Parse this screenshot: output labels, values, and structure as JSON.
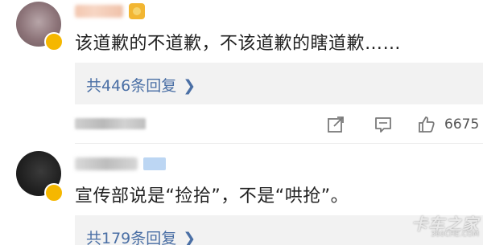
{
  "comments": [
    {
      "text": "该道歉的不道歉，不该道歉的瞎道歉……",
      "reply_link": "共446条回复",
      "like_count": "6675"
    },
    {
      "text": "宣传部说是“捡拾”，不是“哄抢”。",
      "reply_link": "共179条回复"
    }
  ],
  "icons": {
    "reply_arrow": "chevron-right-icon",
    "share": "share-icon",
    "comment": "comment-icon",
    "like": "thumbs-up-icon"
  },
  "colors": {
    "link": "#4a6fa5",
    "text": "#222222",
    "reply_bg": "#f2f2f2",
    "badge": "#f5b700"
  },
  "watermark": {
    "main": "卡车之家",
    "sub": "360CHE.COM"
  }
}
